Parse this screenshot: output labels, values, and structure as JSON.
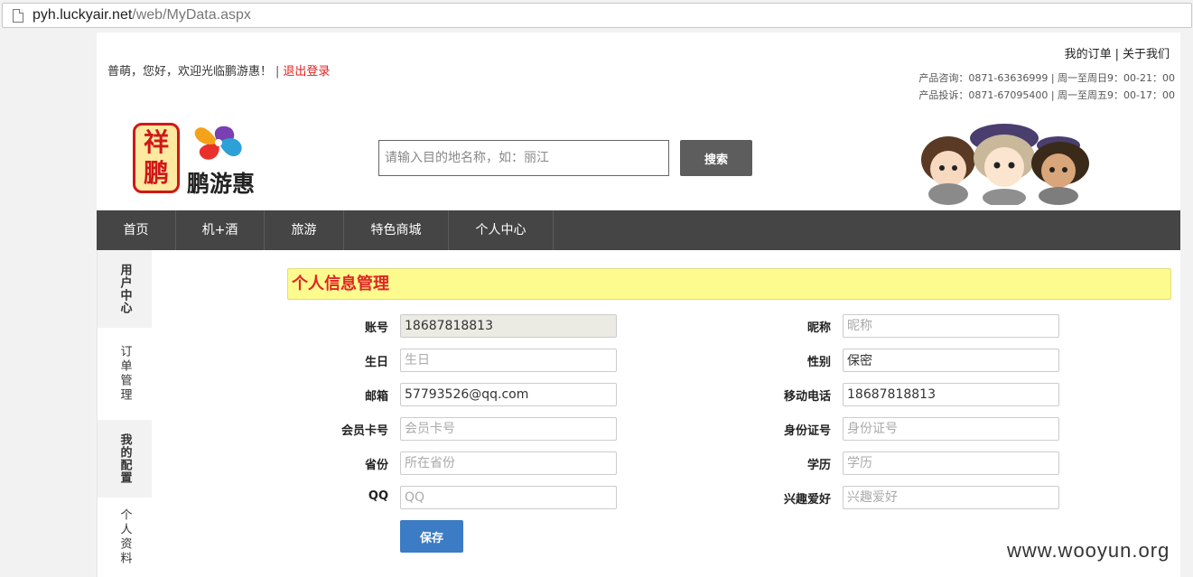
{
  "browser": {
    "url_host": "pyh.luckyair.net",
    "url_path": "/web/MyData.aspx"
  },
  "header": {
    "greeting": "普萌，您好，欢迎光临鹏游惠！",
    "separator": "|",
    "logout": "退出登录",
    "my_orders": "我的订单",
    "about_us": "关于我们",
    "contact_consult": "产品咨询：0871-63636999 | 周一至周日9：00-21：00",
    "contact_complaint": "产品投诉：0871-67095400 | 周一至周五9：00-17：00"
  },
  "logo": {
    "seal_chars": [
      "祥",
      "鹏"
    ],
    "brand": "鹏游惠"
  },
  "search": {
    "placeholder": "请输入目的地名称，如：丽江",
    "button": "搜索"
  },
  "nav": {
    "items": [
      {
        "label": "首页"
      },
      {
        "label": "机+酒"
      },
      {
        "label": "旅游"
      },
      {
        "label": "特色商城"
      },
      {
        "label": "个人中心"
      }
    ]
  },
  "sidebar": {
    "user_center": "用户中心",
    "order_manage": "订单管理",
    "my_config": "我的配置",
    "personal_info": "个人资料"
  },
  "form": {
    "title": "个人信息管理",
    "fields": {
      "account": {
        "label": "账号",
        "value": "18687818813"
      },
      "birthday": {
        "label": "生日",
        "placeholder": "生日"
      },
      "email": {
        "label": "邮箱",
        "value": "57793526@qq.com"
      },
      "member_card": {
        "label": "会员卡号",
        "placeholder": "会员卡号"
      },
      "province": {
        "label": "省份",
        "placeholder": "所在省份"
      },
      "qq": {
        "label": "QQ",
        "placeholder": "QQ"
      },
      "nickname": {
        "label": "昵称",
        "placeholder": "昵称"
      },
      "gender": {
        "label": "性别",
        "value": "保密"
      },
      "mobile": {
        "label": "移动电话",
        "value": "18687818813"
      },
      "id_number": {
        "label": "身份证号",
        "placeholder": "身份证号"
      },
      "education": {
        "label": "学历",
        "placeholder": "学历"
      },
      "hobbies": {
        "label": "兴趣爱好",
        "placeholder": "兴趣爱好"
      }
    },
    "save": "保存"
  },
  "watermark": "www.wooyun.org",
  "colors": {
    "nav_bg": "#454545",
    "title_bg": "#fdfb8e",
    "title_text": "#e02424",
    "save_btn": "#3b7cc4",
    "logout": "#e02020"
  }
}
